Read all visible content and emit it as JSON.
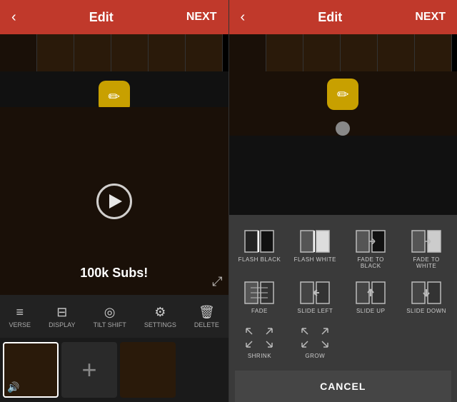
{
  "left": {
    "header": {
      "back_label": "‹",
      "title": "Edit",
      "next_label": "NEXT"
    },
    "video": {
      "title": "100k Subs!"
    },
    "toolbar": {
      "items": [
        {
          "id": "reverse",
          "label": "VERSE",
          "icon": "↩"
        },
        {
          "id": "display",
          "label": "DISPLAY",
          "icon": "⊞"
        },
        {
          "id": "tilt-shift",
          "label": "TILT SHIFT",
          "icon": "◉"
        },
        {
          "id": "settings",
          "label": "SETTINGS",
          "icon": "⚙"
        },
        {
          "id": "delete",
          "label": "DELETE",
          "icon": "🗑"
        }
      ]
    },
    "clip_strip": {
      "add_label": "+"
    }
  },
  "right": {
    "header": {
      "back_label": "‹",
      "title": "Edit",
      "next_label": "NEXT"
    },
    "transitions": {
      "grid": [
        {
          "id": "flash-black",
          "label": "FLASH BLACK"
        },
        {
          "id": "flash-white",
          "label": "FLASH WHITE"
        },
        {
          "id": "fade-to-black",
          "label": "FADE TO BLACK"
        },
        {
          "id": "fade-to-white",
          "label": "FADE TO WHITE"
        },
        {
          "id": "fade",
          "label": "FADE"
        },
        {
          "id": "slide-left",
          "label": "SLIDE LEFT"
        },
        {
          "id": "slide-up",
          "label": "SLIDE UP"
        },
        {
          "id": "slide-down",
          "label": "SLIDE DOWN"
        },
        {
          "id": "shrink",
          "label": "SHRINK"
        },
        {
          "id": "grow",
          "label": "GROW"
        }
      ],
      "cancel_label": "CANCEL"
    }
  }
}
